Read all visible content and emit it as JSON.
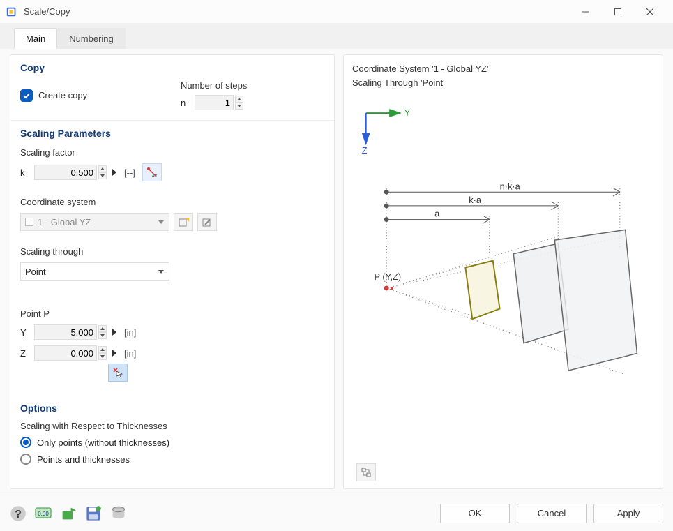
{
  "titlebar": {
    "title": "Scale/Copy"
  },
  "tabs": {
    "main": "Main",
    "numbering": "Numbering",
    "active": "main"
  },
  "copy": {
    "title": "Copy",
    "create_copy_label": "Create copy",
    "create_copy_checked": true,
    "number_of_steps_label": "Number of steps",
    "n_label": "n",
    "n_value": "1"
  },
  "scaling": {
    "title": "Scaling Parameters",
    "factor_label": "Scaling factor",
    "k_label": "k",
    "k_value": "0.500",
    "k_unit": "[--]",
    "coord_label": "Coordinate system",
    "coord_value": "1 - Global YZ",
    "through_label": "Scaling through",
    "through_value": "Point"
  },
  "point": {
    "title": "Point P",
    "y_label": "Y",
    "y_value": "5.000",
    "z_label": "Z",
    "z_value": "0.000",
    "unit": "[in]"
  },
  "options": {
    "title": "Options",
    "respect_label": "Scaling with Respect to Thicknesses",
    "opt1": "Only points (without thicknesses)",
    "opt2": "Points and thicknesses",
    "selected": 1
  },
  "preview": {
    "line1": "Coordinate System '1 - Global YZ'",
    "line2": "Scaling Through 'Point'",
    "axis_y": "Y",
    "axis_z": "Z",
    "lbl_nka": "n·k·a",
    "lbl_ka": "k·a",
    "lbl_a": "a",
    "lbl_p": "P (Y,Z)"
  },
  "footer": {
    "ok": "OK",
    "cancel": "Cancel",
    "apply": "Apply"
  }
}
